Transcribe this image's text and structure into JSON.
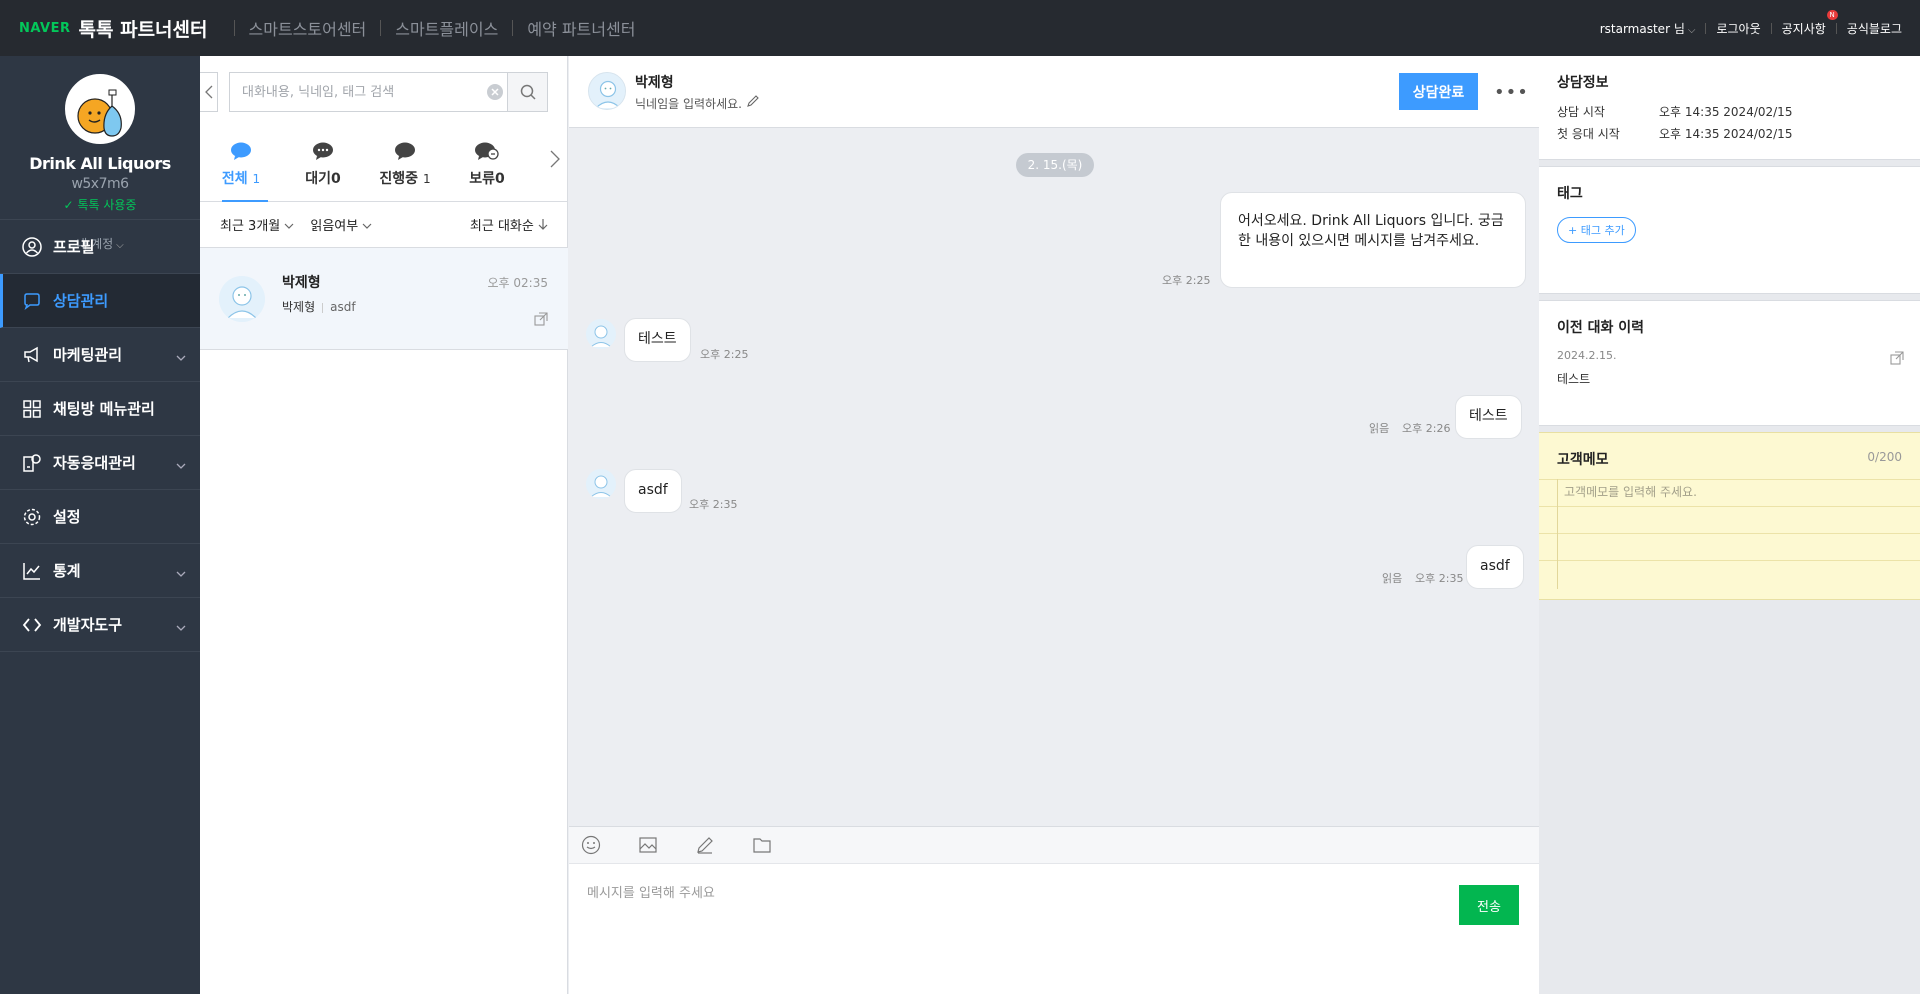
{
  "header": {
    "brand_naver": "NAVER",
    "brand_title": "톡톡 파트너센터",
    "nav": [
      "스마트스토어센터",
      "스마트플레이스",
      "예약 파트너센터"
    ],
    "user": "rstarmaster 님",
    "logout": "로그아웃",
    "notice": "공지사항",
    "notice_badge": "N",
    "blog": "공식블로그"
  },
  "sidebar": {
    "shop_name": "Drink All Liquors",
    "shop_id": "w5x7m6",
    "talk_status": "톡톡 사용중",
    "my_account": "내 계정",
    "items": [
      {
        "label": "프로필",
        "icon": "person-icon",
        "active": false,
        "expandable": false
      },
      {
        "label": "상담관리",
        "icon": "chat-icon",
        "active": true,
        "expandable": false
      },
      {
        "label": "마케팅관리",
        "icon": "megaphone-icon",
        "active": false,
        "expandable": true
      },
      {
        "label": "채팅방 메뉴관리",
        "icon": "grid-icon",
        "active": false,
        "expandable": false
      },
      {
        "label": "자동응대관리",
        "icon": "auto-reply-icon",
        "active": false,
        "expandable": true
      },
      {
        "label": "설정",
        "icon": "gear-icon",
        "active": false,
        "expandable": false
      },
      {
        "label": "통계",
        "icon": "chart-icon",
        "active": false,
        "expandable": true
      },
      {
        "label": "개발자도구",
        "icon": "code-icon",
        "active": false,
        "expandable": true
      }
    ]
  },
  "list": {
    "search_placeholder": "대화내용, 닉네임, 태그 검색",
    "tabs": [
      {
        "label": "전체",
        "count": "1",
        "active": true
      },
      {
        "label": "대기",
        "count": "0",
        "active": false
      },
      {
        "label": "진행중",
        "count": "1",
        "active": false
      },
      {
        "label": "보류",
        "count": "0",
        "active": false
      }
    ],
    "filter_period": "최근 3개월",
    "filter_read": "읽음여부",
    "filter_sort": "최근 대화순",
    "conversations": [
      {
        "name": "박제형",
        "time": "오후 02:35",
        "nickname": "박제형",
        "last_message": "asdf"
      }
    ]
  },
  "chat": {
    "name": "박제형",
    "nickname_placeholder": "닉네임을 입력하세요.",
    "complete_button": "상담완료",
    "date_divider": "2. 15.(목)",
    "messages": [
      {
        "side": "out",
        "text": "어서오세요. Drink All Liquors 입니다. 궁금한 내용이 있으시면 메시지를 남겨주세요.",
        "read": "",
        "time": "오후 2:25"
      },
      {
        "side": "in",
        "text": "테스트",
        "read": "",
        "time": "오후 2:25"
      },
      {
        "side": "out",
        "text": "테스트",
        "read": "읽음",
        "time": "오후 2:26"
      },
      {
        "side": "in",
        "text": "asdf",
        "read": "",
        "time": "오후 2:35"
      },
      {
        "side": "out",
        "text": "asdf",
        "read": "읽음",
        "time": "오후 2:35"
      }
    ],
    "input_placeholder": "메시지를 입력해 주세요",
    "send_button": "전송"
  },
  "info": {
    "consult_title": "상담정보",
    "start_label": "상담 시작",
    "start_value": "오후 14:35 2024/02/15",
    "first_reply_label": "첫 응대 시작",
    "first_reply_value": "오후 14:35 2024/02/15",
    "tag_title": "태그",
    "tag_add": "+ 태그 추가",
    "history_title": "이전 대화 이력",
    "history_date": "2024.2.15.",
    "history_text": "테스트",
    "memo_title": "고객메모",
    "memo_count": "0/200",
    "memo_placeholder": "고객메모를 입력해 주세요."
  },
  "colors": {
    "accent": "#3d9bff",
    "naver_green": "#03c75a",
    "send_green": "#03b650",
    "sidebar_bg": "#2e3744",
    "topbar_bg": "#262a30"
  }
}
